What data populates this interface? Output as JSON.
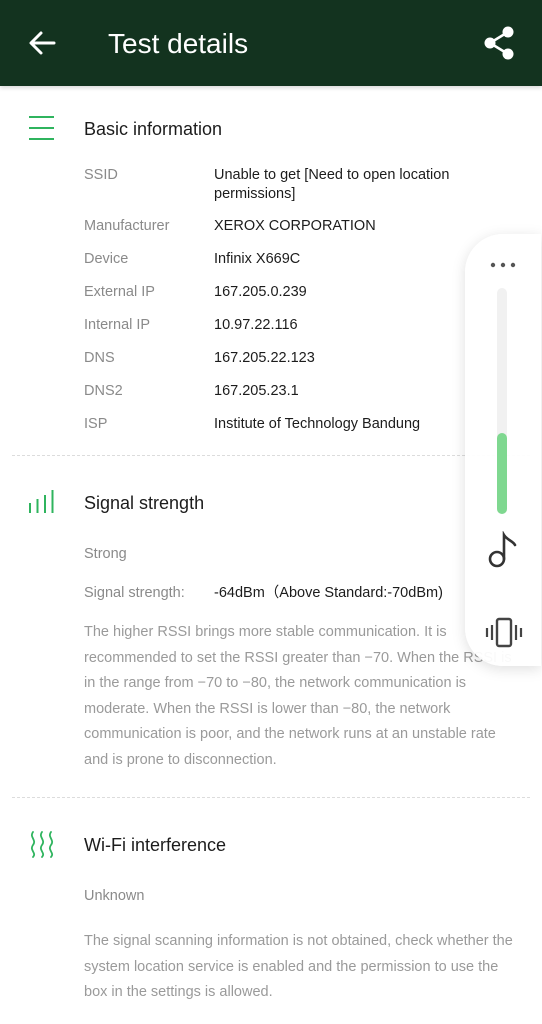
{
  "header": {
    "title": "Test details",
    "back_icon": "arrow-left-icon",
    "share_icon": "share-icon",
    "bar_color": "#13331f"
  },
  "accent_color": "#2fb45e",
  "basic_info": {
    "title": "Basic information",
    "icon": "list-icon",
    "rows": [
      {
        "label": "SSID",
        "value": "Unable to get [Need to open location permissions]"
      },
      {
        "label": "Manufacturer",
        "value": "XEROX CORPORATION"
      },
      {
        "label": "Device",
        "value": "Infinix X669C"
      },
      {
        "label": "External IP",
        "value": "167.205.0.239"
      },
      {
        "label": "Internal IP",
        "value": "10.97.22.116"
      },
      {
        "label": "DNS",
        "value": "167.205.22.123"
      },
      {
        "label": "DNS2",
        "value": "167.205.23.1"
      },
      {
        "label": "ISP",
        "value": "Institute of Technology Bandung"
      }
    ]
  },
  "signal": {
    "title": "Signal strength",
    "icon": "signal-bars-icon",
    "quality": "Strong",
    "label": "Signal strength:",
    "value": "-64dBm（Above Standard:-70dBm)",
    "description": "The higher RSSI brings more stable communication. It is recommended to set the RSSI greater than −70. When the RSSI is in the range from −70 to −80, the network communication is moderate. When the RSSI is lower than −80, the network communication is poor, and the network runs at an unstable rate and is prone to disconnection."
  },
  "interference": {
    "title": "Wi-Fi interference",
    "icon": "waves-icon",
    "status": "Unknown",
    "description": "The signal scanning information is not obtained, check whether the system location service is enabled and the permission to use the box in the settings is allowed."
  },
  "volume_panel": {
    "more_icon": "more-dots-icon",
    "level_percent": 36,
    "media_icon": "music-note-icon",
    "ring_icon": "vibrate-icon"
  }
}
